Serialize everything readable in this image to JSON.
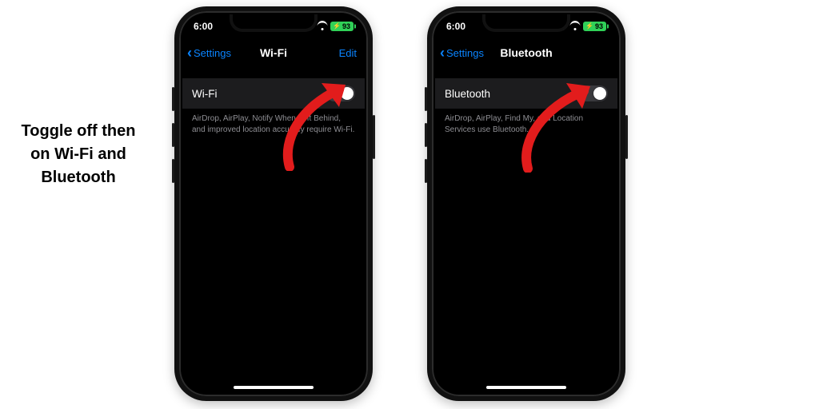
{
  "caption": "Toggle off then on Wi-Fi and Bluetooth",
  "status": {
    "time": "6:00",
    "battery": "93"
  },
  "nav": {
    "back": "Settings",
    "edit": "Edit"
  },
  "phones": {
    "wifi": {
      "title": "Wi-Fi",
      "row_label": "Wi-Fi",
      "footnote": "AirDrop, AirPlay, Notify When Left Behind, and improved location accuracy require Wi-Fi."
    },
    "bt": {
      "title": "Bluetooth",
      "row_label": "Bluetooth",
      "footnote": "AirDrop, AirPlay, Find My, and Location Services use Bluetooth."
    }
  }
}
